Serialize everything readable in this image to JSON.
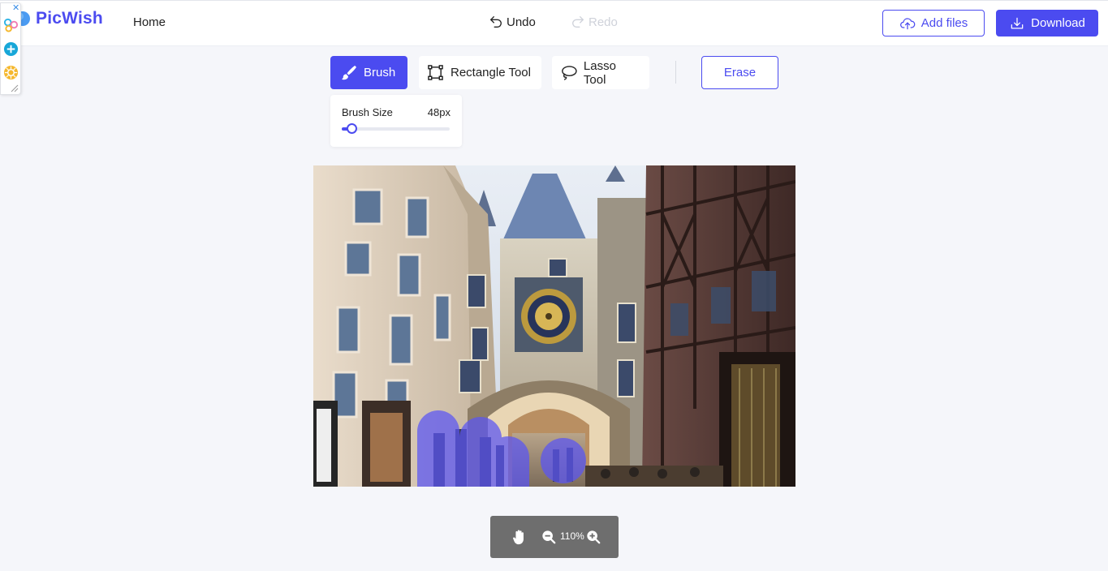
{
  "header": {
    "app_name": "PicWish",
    "nav_home": "Home",
    "undo_label": "Undo",
    "redo_label": "Redo",
    "add_files_label": "Add files",
    "download_label": "Download"
  },
  "toolbar": {
    "tools": [
      {
        "label": "Brush",
        "active": true
      },
      {
        "label": "Rectangle Tool",
        "active": false
      },
      {
        "label": "Lasso Tool",
        "active": false
      }
    ],
    "erase_label": "Erase"
  },
  "brush": {
    "label": "Brush Size",
    "value_text": "48px",
    "slider_fraction": 0.09
  },
  "zoom": {
    "level": "110%"
  },
  "colors": {
    "accent": "#4b4bf0",
    "zoom_bar": "#6e6e6e",
    "background": "#f5f6fa"
  }
}
